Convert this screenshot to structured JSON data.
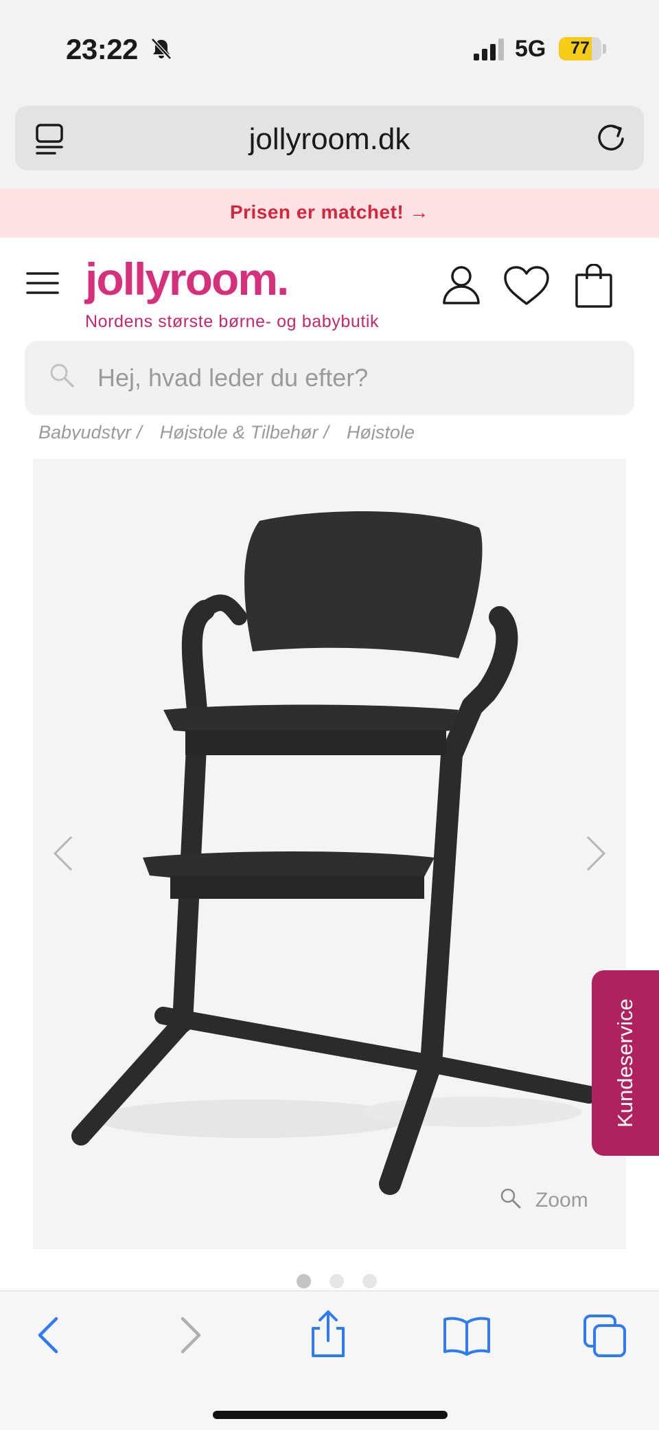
{
  "status_bar": {
    "time": "23:22",
    "network": "5G",
    "battery_percent": 77,
    "battery_label": "77",
    "icons": [
      "bell-slash-icon",
      "signal-bars-icon",
      "battery-icon"
    ]
  },
  "browser": {
    "url": "jollyroom.dk",
    "icons": [
      "reader-mode-icon",
      "reload-icon"
    ]
  },
  "promo": {
    "text": "Prisen er matchet! →"
  },
  "header": {
    "logo": "jollyroom.",
    "tagline": "Nordens største børne- og babybutik",
    "icons": [
      "menu-icon",
      "user-icon",
      "heart-icon",
      "shopping-bag-icon"
    ]
  },
  "search": {
    "placeholder": "Hej, hvad leder du efter?"
  },
  "breadcrumb": [
    "Babyudstyr",
    "Højstole & Tilbehør",
    "Højstole"
  ],
  "breadcrumb_sep": "/",
  "product": {
    "zoom_label": "Zoom",
    "image_count": 3,
    "current_image": 1
  },
  "kundeservice": {
    "label": "Kundeservice"
  },
  "colors": {
    "brand_pink": "#d6307c",
    "promo_bg": "#fde3e3",
    "promo_text": "#d6253c",
    "kundeservice_bg": "#b0225e",
    "safari_blue": "#2f7bf5"
  },
  "toolbar": {
    "icons": [
      "back-icon",
      "forward-icon",
      "share-icon",
      "bookmarks-icon",
      "tabs-icon"
    ]
  }
}
